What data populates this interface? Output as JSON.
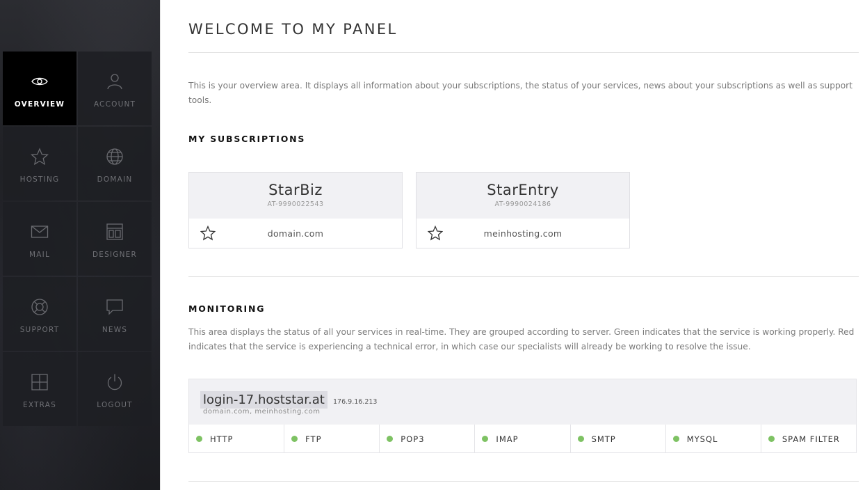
{
  "sidebar": {
    "items": [
      {
        "label": "OVERVIEW",
        "icon": "eye-icon",
        "active": true
      },
      {
        "label": "ACCOUNT",
        "icon": "user-icon"
      },
      {
        "label": "HOSTING",
        "icon": "star-icon"
      },
      {
        "label": "DOMAIN",
        "icon": "globe-icon"
      },
      {
        "label": "MAIL",
        "icon": "envelope-icon"
      },
      {
        "label": "DESIGNER",
        "icon": "layout-icon"
      },
      {
        "label": "SUPPORT",
        "icon": "lifebuoy-icon"
      },
      {
        "label": "NEWS",
        "icon": "speech-bubble-icon"
      },
      {
        "label": "EXTRAS",
        "icon": "plus-square-icon"
      },
      {
        "label": "LOGOUT",
        "icon": "power-icon"
      }
    ]
  },
  "main": {
    "title": "WELCOME TO MY PANEL",
    "intro": "This is your overview area. It displays all information about your subscriptions, the status of your services, news about your subscriptions as well as support tools.",
    "subscriptions": {
      "title": "MY SUBSCRIPTIONS",
      "cards": [
        {
          "name": "StarBiz",
          "id": "AT-9990022543",
          "domain": "domain.com"
        },
        {
          "name": "StarEntry",
          "id": "AT-9990024186",
          "domain": "meinhosting.com"
        }
      ]
    },
    "monitoring": {
      "title": "MONITORING",
      "description": "This area displays the status of all your services in real-time. They are grouped according to server. Green indicates that the service is working properly. Red indicates that the service is experiencing a technical error, in which case our specialists will already be working to resolve the issue.",
      "server": {
        "host": "login-17.hoststar.at",
        "ip": "176.9.16.213",
        "domains": "domain.com, meinhosting.com",
        "services": [
          "HTTP",
          "FTP",
          "POP3",
          "IMAP",
          "SMTP",
          "MYSQL",
          "SPAM FILTER"
        ],
        "status_color": "#7ec263"
      }
    }
  }
}
